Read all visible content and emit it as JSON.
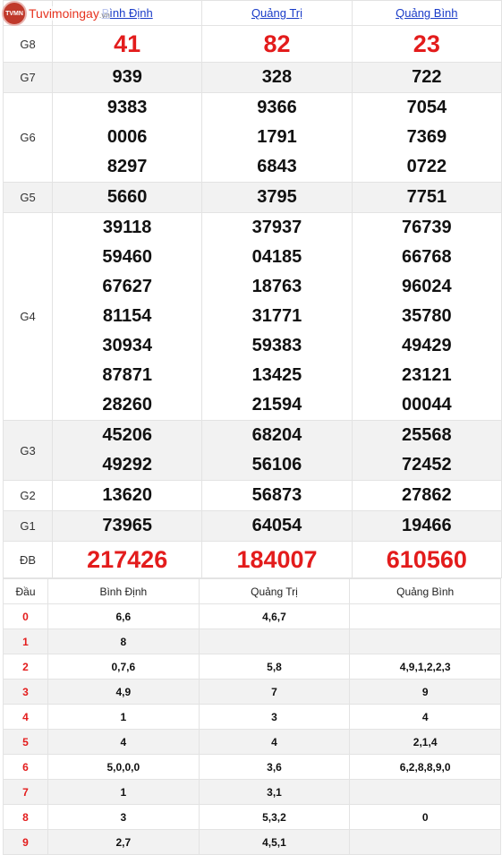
{
  "logo": {
    "text": "Tuvimoingay",
    "suffix": ".vn",
    "badge": "TVMN"
  },
  "provinces": [
    "Bình Định",
    "Quảng Trị",
    "Quảng Bình"
  ],
  "prizes": [
    {
      "label": "G8",
      "values": [
        [
          "41"
        ],
        [
          "82"
        ],
        [
          "23"
        ]
      ]
    },
    {
      "label": "G7",
      "values": [
        [
          "939"
        ],
        [
          "328"
        ],
        [
          "722"
        ]
      ]
    },
    {
      "label": "G6",
      "values": [
        [
          "9383",
          "0006",
          "8297"
        ],
        [
          "9366",
          "1791",
          "6843"
        ],
        [
          "7054",
          "7369",
          "0722"
        ]
      ]
    },
    {
      "label": "G5",
      "values": [
        [
          "5660"
        ],
        [
          "3795"
        ],
        [
          "7751"
        ]
      ]
    },
    {
      "label": "G4",
      "values": [
        [
          "39118",
          "59460",
          "67627",
          "81154",
          "30934",
          "87871",
          "28260"
        ],
        [
          "37937",
          "04185",
          "18763",
          "31771",
          "59383",
          "13425",
          "21594"
        ],
        [
          "76739",
          "66768",
          "96024",
          "35780",
          "49429",
          "23121",
          "00044"
        ]
      ]
    },
    {
      "label": "G3",
      "values": [
        [
          "45206",
          "49292"
        ],
        [
          "68204",
          "56106"
        ],
        [
          "25568",
          "72452"
        ]
      ]
    },
    {
      "label": "G2",
      "values": [
        [
          "13620"
        ],
        [
          "56873"
        ],
        [
          "27862"
        ]
      ]
    },
    {
      "label": "G1",
      "values": [
        [
          "73965"
        ],
        [
          "64054"
        ],
        [
          "19466"
        ]
      ]
    },
    {
      "label": "ĐB",
      "values": [
        [
          "217426"
        ],
        [
          "184007"
        ],
        [
          "610560"
        ]
      ]
    }
  ],
  "loto": {
    "header": "Đầu",
    "rows": [
      {
        "dau": "0",
        "values": [
          "6,6",
          "4,6,7",
          ""
        ]
      },
      {
        "dau": "1",
        "values": [
          "8",
          "",
          ""
        ]
      },
      {
        "dau": "2",
        "values": [
          "0,7,6",
          "5,8",
          "4,9,1,2,2,3"
        ]
      },
      {
        "dau": "3",
        "values": [
          "4,9",
          "7",
          "9"
        ]
      },
      {
        "dau": "4",
        "values": [
          "1",
          "3",
          "4"
        ]
      },
      {
        "dau": "5",
        "values": [
          "4",
          "4",
          "2,1,4"
        ]
      },
      {
        "dau": "6",
        "values": [
          "5,0,0,0",
          "3,6",
          "6,2,8,8,9,0"
        ]
      },
      {
        "dau": "7",
        "values": [
          "1",
          "3,1",
          ""
        ]
      },
      {
        "dau": "8",
        "values": [
          "3",
          "5,3,2",
          "0"
        ]
      },
      {
        "dau": "9",
        "values": [
          "2,7",
          "4,5,1",
          ""
        ]
      }
    ]
  }
}
